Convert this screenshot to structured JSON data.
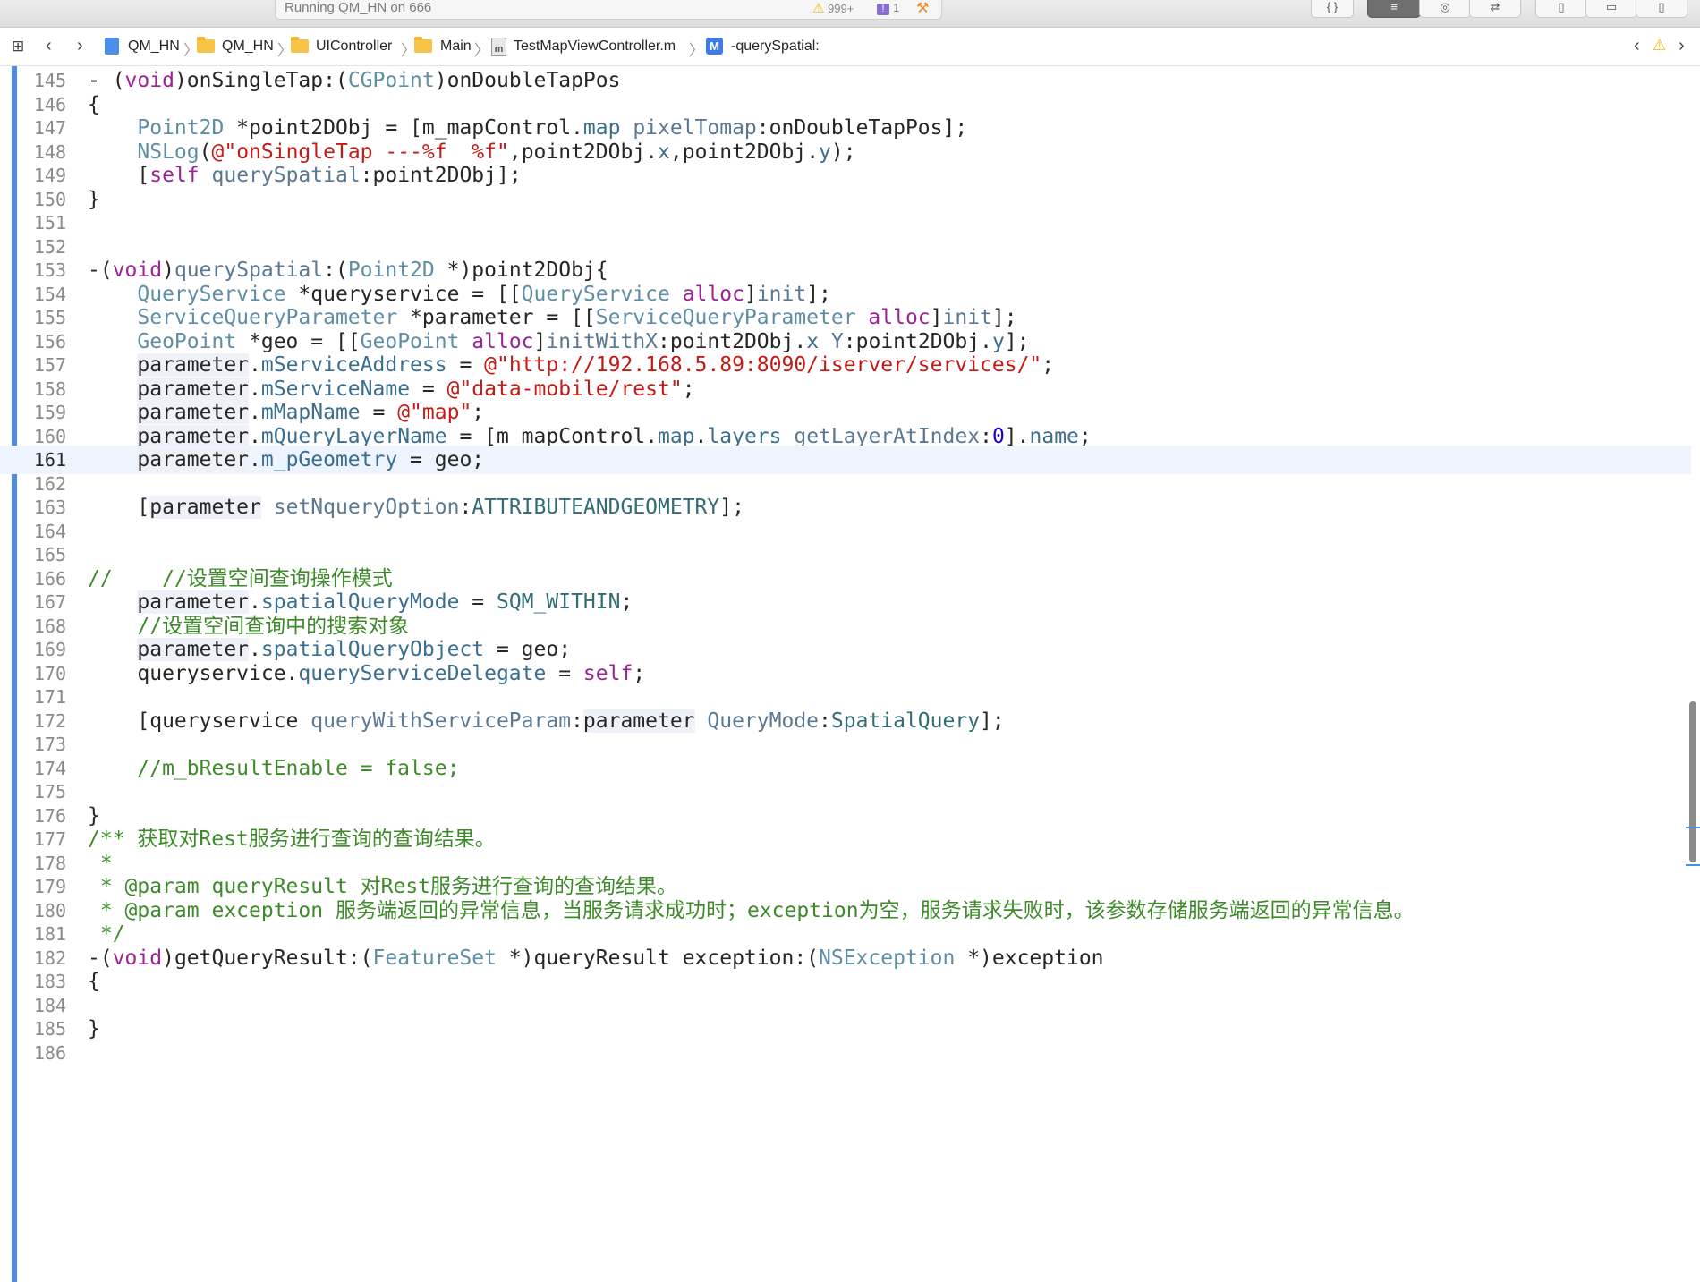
{
  "toolbar": {
    "activity": "Running QM_HN on 666",
    "warnings": "999+",
    "issues": "1",
    "buttons": [
      "{ }",
      "≡",
      "◎",
      "⇄",
      "▯",
      "▭",
      "▯"
    ]
  },
  "jumpbar": {
    "crumbs": [
      {
        "label": "QM_HN",
        "icon": "project-icon"
      },
      {
        "label": "QM_HN",
        "icon": "folder-icon"
      },
      {
        "label": "UIController",
        "icon": "folder-icon"
      },
      {
        "label": "Main",
        "icon": "folder-icon"
      },
      {
        "label": "TestMapViewController.m",
        "icon": "m-file-icon"
      },
      {
        "label": "-querySpatial:",
        "icon": "method-icon"
      }
    ]
  },
  "editor": {
    "current_line": "161",
    "lines": [
      {
        "n": "145",
        "code": "- (void)onSingleTap:(CGPoint)onDoubleTapPos"
      },
      {
        "n": "146",
        "code": "{"
      },
      {
        "n": "147",
        "code": "    Point2D *point2DObj = [m_mapControl.map pixelTomap:onDoubleTapPos];"
      },
      {
        "n": "148",
        "code": "    NSLog(@\"onSingleTap ---%f  %f\",point2DObj.x,point2DObj.y);"
      },
      {
        "n": "149",
        "code": "    [self querySpatial:point2DObj];"
      },
      {
        "n": "150",
        "code": "}"
      },
      {
        "n": "151",
        "code": ""
      },
      {
        "n": "152",
        "code": ""
      },
      {
        "n": "153",
        "code": "-(void)querySpatial:(Point2D *)point2DObj{"
      },
      {
        "n": "154",
        "code": "    QueryService *queryservice = [[QueryService alloc]init];"
      },
      {
        "n": "155",
        "code": "    ServiceQueryParameter *parameter = [[ServiceQueryParameter alloc]init];"
      },
      {
        "n": "156",
        "code": "    GeoPoint *geo = [[GeoPoint alloc]initWithX:point2DObj.x Y:point2DObj.y];"
      },
      {
        "n": "157",
        "code": "    parameter.mServiceAddress = @\"http://192.168.5.89:8090/iserver/services/\";"
      },
      {
        "n": "158",
        "code": "    parameter.mServiceName = @\"data-mobile/rest\";"
      },
      {
        "n": "159",
        "code": "    parameter.mMapName = @\"map\";"
      },
      {
        "n": "160",
        "code": "    parameter.mQueryLayerName = [m_mapControl.map.layers getLayerAtIndex:0].name;"
      },
      {
        "n": "161",
        "code": "    parameter.m_pGeometry = geo;"
      },
      {
        "n": "162",
        "code": ""
      },
      {
        "n": "163",
        "code": "    [parameter setNqueryOption:ATTRIBUTEANDGEOMETRY];"
      },
      {
        "n": "164",
        "code": ""
      },
      {
        "n": "165",
        "code": ""
      },
      {
        "n": "166",
        "code": "//    //设置空间查询操作模式"
      },
      {
        "n": "167",
        "code": "    parameter.spatialQueryMode = SQM_WITHIN;"
      },
      {
        "n": "168",
        "code": "    //设置空间查询中的搜索对象"
      },
      {
        "n": "169",
        "code": "    parameter.spatialQueryObject = geo;"
      },
      {
        "n": "170",
        "code": "    queryservice.queryServiceDelegate = self;"
      },
      {
        "n": "171",
        "code": ""
      },
      {
        "n": "172",
        "code": "    [queryservice queryWithServiceParam:parameter QueryMode:SpatialQuery];"
      },
      {
        "n": "173",
        "code": ""
      },
      {
        "n": "174",
        "code": "    //m_bResultEnable = false;"
      },
      {
        "n": "175",
        "code": ""
      },
      {
        "n": "176",
        "code": "}"
      },
      {
        "n": "177",
        "code": "/** 获取对Rest服务进行查询的查询结果。"
      },
      {
        "n": "178",
        "code": " *"
      },
      {
        "n": "179",
        "code": " * @param queryResult 对Rest服务进行查询的查询结果。"
      },
      {
        "n": "180",
        "code": " * @param exception 服务端返回的异常信息，当服务请求成功时；exception为空，服务请求失败时，该参数存储服务端返回的异常信息。"
      },
      {
        "n": "181",
        "code": " */"
      },
      {
        "n": "182",
        "code": "-(void)getQueryResult:(FeatureSet *)queryResult exception:(NSException *)exception"
      },
      {
        "n": "183",
        "code": "{"
      },
      {
        "n": "184",
        "code": ""
      },
      {
        "n": "185",
        "code": "}"
      },
      {
        "n": "186",
        "code": ""
      }
    ]
  },
  "colors": {
    "keyword": "#9b2393",
    "class": "#5e8ea3",
    "string": "#c41a16",
    "comment": "#3e8a2a",
    "accent": "#4d8be9"
  }
}
